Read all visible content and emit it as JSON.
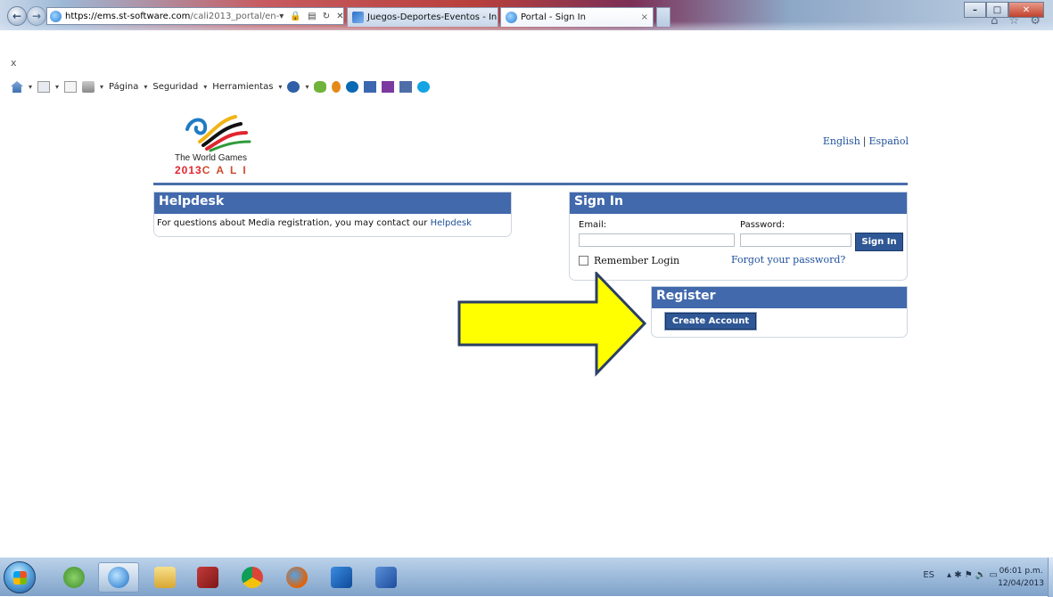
{
  "browser": {
    "url_host": "https://ems.st-software.com",
    "url_path": "/cali2013_portal/en-",
    "url_actions": "▾ 🔒 ▤ ↻ ✕",
    "tabs": [
      {
        "title": "Juegos-Deportes-Eventos - Ini..."
      },
      {
        "title": "Portal - Sign In",
        "close": "×"
      }
    ],
    "back": "←",
    "forward": "→",
    "window_controls": {
      "minimize": "–",
      "maximize": "□",
      "close": "✕"
    },
    "right_icons": "⌂ ☆ ⚙",
    "close_x": "x",
    "command_bar": {
      "pagina": "Página",
      "seguridad": "Seguridad",
      "herramientas": "Herramientas",
      "caret": "▾"
    }
  },
  "page": {
    "logo": {
      "line1": "The World Games",
      "line2_year": "2013",
      "line2_city": "CALI"
    },
    "language": {
      "english": "English",
      "separator": "|",
      "spanish": "Español"
    },
    "helpdesk": {
      "title": "Helpdesk",
      "text": "For questions about Media registration, you may contact our ",
      "link": "Helpdesk"
    },
    "signin": {
      "title": "Sign In",
      "email_label": "Email:",
      "email_value": "",
      "password_label": "Password:",
      "password_value": "",
      "button": "Sign In",
      "remember": "Remember Login",
      "forgot": "Forgot your password?"
    },
    "register": {
      "title": "Register",
      "button": "Create Account"
    },
    "arrow_color": "#ffff00"
  },
  "taskbar": {
    "apps": [
      "start",
      "people",
      "internet-explorer",
      "file-explorer",
      "photoshop-elements",
      "chrome",
      "firefox",
      "outlook",
      "word"
    ],
    "tray_lang": "ES",
    "tray_icons": "▴ ✱ ⚑ 🔈 ▭",
    "time": "06:01 p.m.",
    "date": "12/04/2013"
  }
}
